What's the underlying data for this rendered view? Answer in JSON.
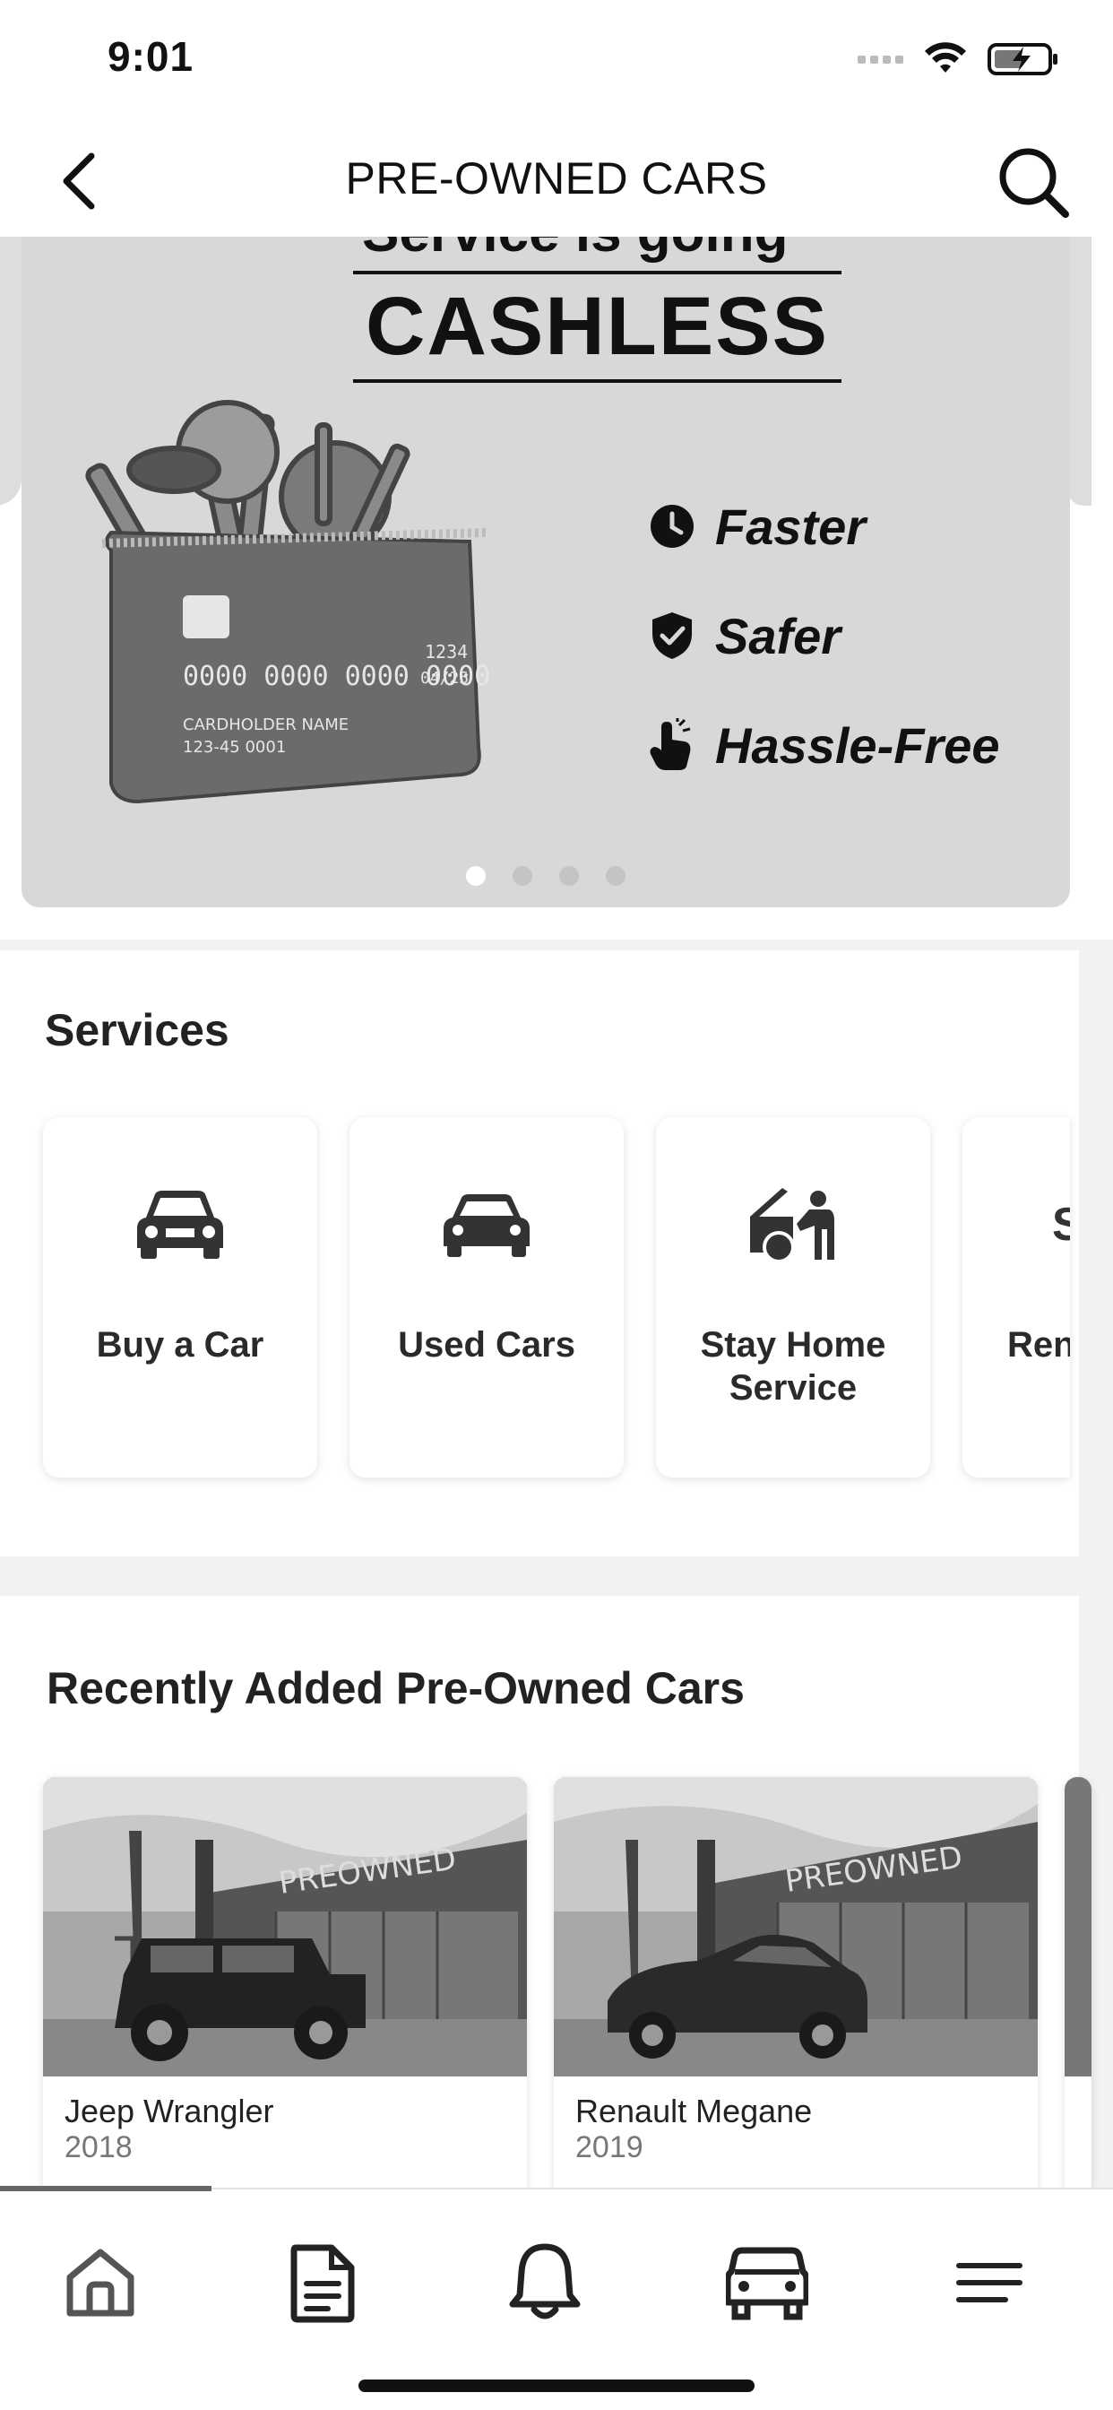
{
  "status_bar": {
    "time": "9:01"
  },
  "header": {
    "title": "PRE-OWNED CARS"
  },
  "banner": {
    "cut_text": "Service is going",
    "headline": "CASHLESS",
    "features": [
      {
        "label": "Faster",
        "icon": "clock-icon"
      },
      {
        "label": "Safer",
        "icon": "shield-check-icon"
      },
      {
        "label": "Hassle-Free",
        "icon": "tap-hand-icon"
      }
    ],
    "card": {
      "number": "0000 0000 0000 0000",
      "cvv": "1234",
      "expiry": "04/25",
      "holder": "CARDHOLDER NAME",
      "account": "123-45 0001"
    },
    "page_count": 4,
    "active_page": 1
  },
  "services": {
    "title": "Services",
    "items": [
      {
        "label": "Buy a Car",
        "icon": "car-front-icon"
      },
      {
        "label": "Used Cars",
        "icon": "car-icon"
      },
      {
        "label": "Stay Home Service",
        "icon": "mechanic-icon"
      },
      {
        "label": "Rent",
        "icon": "rent-icon"
      }
    ]
  },
  "recent": {
    "title": "Recently Added Pre-Owned Cars",
    "cars": [
      {
        "name": "Jeep Wrangler",
        "year": "2018",
        "sign": "PREOWNED"
      },
      {
        "name": "Renault Megane",
        "year": "2019",
        "sign": "PREOWNED"
      }
    ]
  },
  "tabbar": {
    "tabs": [
      {
        "name": "home",
        "icon": "home-icon"
      },
      {
        "name": "documents",
        "icon": "document-icon"
      },
      {
        "name": "notifications",
        "icon": "bell-icon"
      },
      {
        "name": "cars",
        "icon": "car-icon"
      },
      {
        "name": "menu",
        "icon": "menu-icon"
      }
    ]
  }
}
